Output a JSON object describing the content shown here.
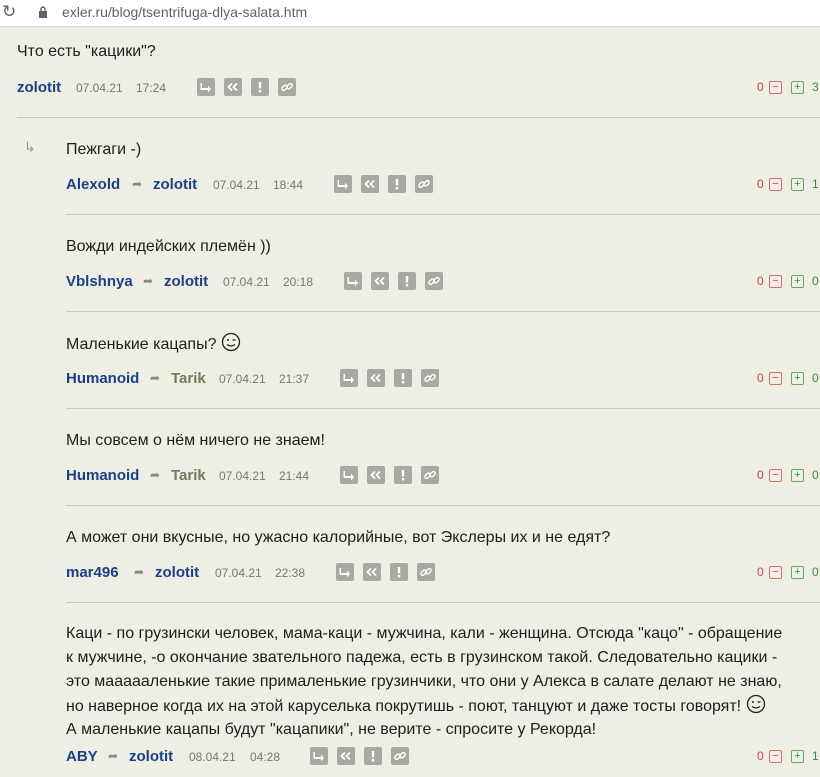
{
  "browser": {
    "url": "exler.ru/blog/tsentrifuga-dlya-salata.htm"
  },
  "comments": [
    {
      "text": "Что есть \"кацики\"?",
      "author": "zolotit",
      "date": "07.04.21",
      "time": "17:24",
      "minus": "0",
      "plus": "3"
    },
    {
      "text": "Пежгаги -)",
      "author": "Alexold",
      "reply_to": "zolotit",
      "date": "07.04.21",
      "time": "18:44",
      "minus": "0",
      "plus": "1"
    },
    {
      "text": "Вожди индейских племён ))",
      "author": "Vblshnya",
      "reply_to": "zolotit",
      "date": "07.04.21",
      "time": "20:18",
      "minus": "0",
      "plus": "0"
    },
    {
      "text": "Маленькие кацапы?",
      "author": "Humanoid",
      "reply_to": "Tarik",
      "date": "07.04.21",
      "time": "21:37",
      "minus": "0",
      "plus": "0"
    },
    {
      "text": "Мы совсем о нём ничего не знаем!",
      "author": "Humanoid",
      "reply_to": "Tarik",
      "date": "07.04.21",
      "time": "21:44",
      "minus": "0",
      "plus": "0"
    },
    {
      "text": "А может они вкусные, но ужасно калорийные, вот Экслеры их и не едят?",
      "author": "mar496",
      "reply_to": "zolotit",
      "date": "07.04.21",
      "time": "22:38",
      "minus": "0",
      "plus": "0"
    },
    {
      "lines": [
        "Каци - по грузински человек, мама-каци - мужчина, кали - женщина. Отсюда \"кацо\" - обращение",
        "к мужчине, -о окончание звательного падежа, есть в грузинском такой. Следовательно кацики -",
        "это маааааленькие такие прималенькие грузинчики, что они у Алекса в салате делают не знаю,",
        "но наверное когда их на этой каруселька покрутишь - поют, танцуют и даже тосты говорят!",
        "А маленькие кацапы будут \"кацапики\", не верите - спросите у Рекорда!"
      ],
      "author": "ABY",
      "reply_to": "zolotit",
      "date": "08.04.21",
      "time": "04:28",
      "minus": "0",
      "plus": "1"
    }
  ],
  "icons": {
    "reply": "reply-arrow-icon",
    "quote": "quote-icon",
    "report": "exclamation-icon",
    "link": "link-icon"
  },
  "colors": {
    "background": "#eeeee4",
    "author": "#1d3f86",
    "minus": "#c4444a",
    "plus": "#3d8a3d"
  }
}
